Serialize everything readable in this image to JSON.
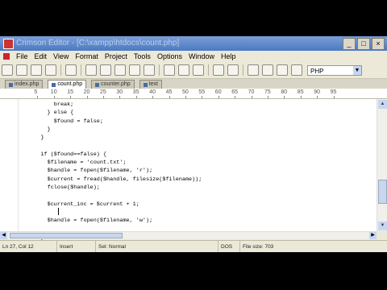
{
  "window": {
    "title": "Crimson Editor - [C:\\xampp\\htdocs\\count.php]",
    "buttons": {
      "minimize": "_",
      "maximize": "□",
      "close": "×"
    }
  },
  "menu": [
    "File",
    "Edit",
    "View",
    "Format",
    "Project",
    "Tools",
    "Options",
    "Window",
    "Help"
  ],
  "toolbar": {
    "language": "PHP"
  },
  "tabs": [
    {
      "label": "index.php"
    },
    {
      "label": "count.php"
    },
    {
      "label": "counter.php"
    },
    {
      "label": "text"
    }
  ],
  "ruler": {
    "labels": [
      "5",
      "10",
      "15",
      "20",
      "25",
      "30",
      "35",
      "40",
      "45",
      "50",
      "55",
      "60",
      "65",
      "70",
      "75",
      "80",
      "85",
      "90",
      "95"
    ]
  },
  "code": [
    "          break;",
    "        } else {",
    "          $found = false;",
    "        }",
    "      }",
    "",
    "      if ($found==false) {",
    "        $filename = 'count.txt';",
    "        $handle = fopen($filename, 'r');",
    "        $current = fread($handle, filesize($filename));",
    "        fclose($handle);",
    "",
    "        $current_inc = $current + 1;",
    "",
    "        $handle = fopen($filename, 'w');",
    "",
    "      }",
    "    }"
  ],
  "status": {
    "position": "Ln 27, Col 12",
    "mode": "Insert",
    "selection": "Sel: Normal",
    "encoding": "DOS",
    "filesize": "File size: 703"
  }
}
